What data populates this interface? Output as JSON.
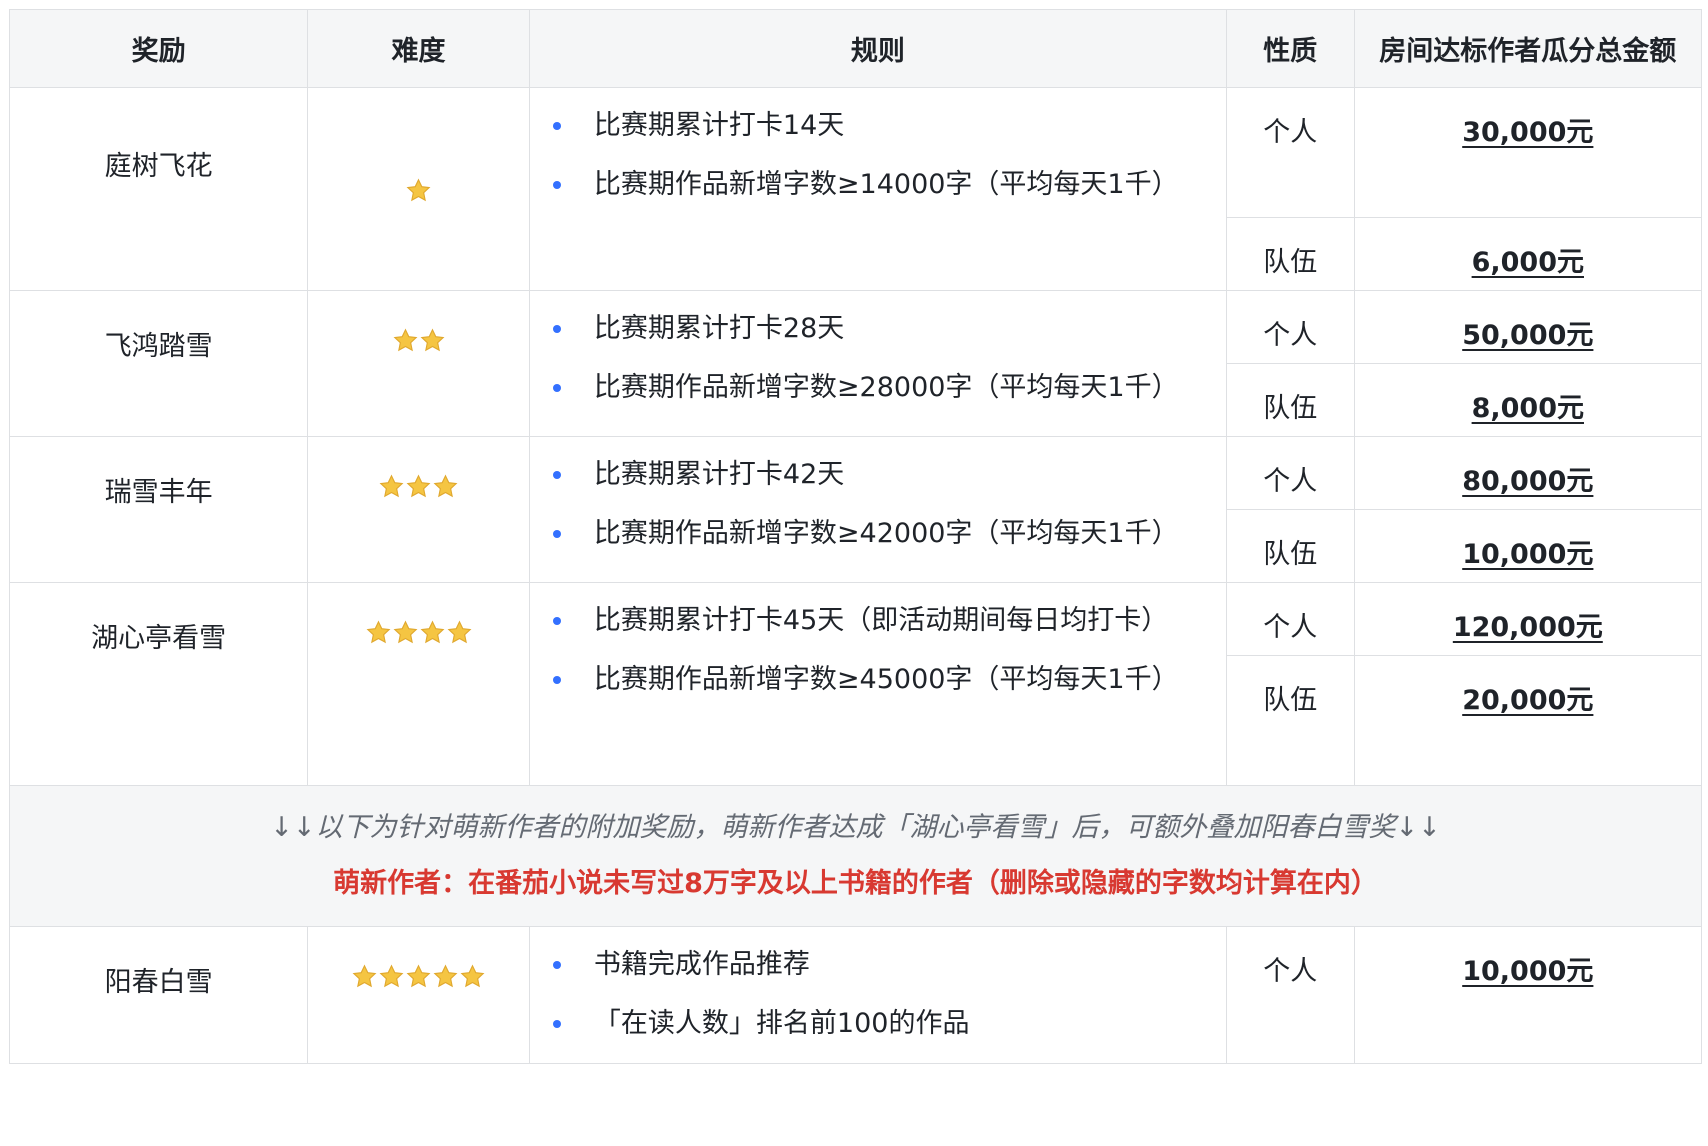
{
  "header": {
    "reward": "奖励",
    "difficulty": "难度",
    "rules": "规则",
    "type": "性质",
    "amount": "房间达标作者瓜分总金额"
  },
  "rows": [
    {
      "name": "庭树飞花",
      "stars": 1,
      "rules": [
        "比赛期累计打卡14天",
        "比赛期作品新增字数≥14000字（平均每天1千）"
      ],
      "tiers": [
        {
          "type": "个人",
          "amount": "30,000元"
        },
        {
          "type": "队伍",
          "amount": "6,000元"
        }
      ]
    },
    {
      "name": "飞鸿踏雪",
      "stars": 2,
      "rules": [
        "比赛期累计打卡28天",
        "比赛期作品新增字数≥28000字（平均每天1千）"
      ],
      "tiers": [
        {
          "type": "个人",
          "amount": "50,000元"
        },
        {
          "type": "队伍",
          "amount": "8,000元"
        }
      ]
    },
    {
      "name": "瑞雪丰年",
      "stars": 3,
      "rules": [
        "比赛期累计打卡42天",
        "比赛期作品新增字数≥42000字（平均每天1千）"
      ],
      "tiers": [
        {
          "type": "个人",
          "amount": "80,000元"
        },
        {
          "type": "队伍",
          "amount": "10,000元"
        }
      ]
    },
    {
      "name": "湖心亭看雪",
      "stars": 4,
      "rules": [
        "比赛期累计打卡45天（即活动期间每日均打卡）",
        "比赛期作品新增字数≥45000字（平均每天1千）"
      ],
      "tiers": [
        {
          "type": "个人",
          "amount": "120,000元"
        },
        {
          "type": "队伍",
          "amount": "20,000元"
        }
      ]
    }
  ],
  "note": {
    "line1": "↓↓以下为针对萌新作者的附加奖励，萌新作者达成「湖心亭看雪」后，可额外叠加阳春白雪奖↓↓",
    "line2": "萌新作者：在番茄小说未写过8万字及以上书籍的作者（删除或隐藏的字数均计算在内）"
  },
  "bonus": {
    "name": "阳春白雪",
    "stars": 5,
    "rules": [
      "书籍完成作品推荐",
      "「在读人数」排名前100的作品"
    ],
    "type": "个人",
    "amount": "10,000元"
  },
  "colors": {
    "border": "#dee0e3",
    "header_bg": "#f5f6f7",
    "bullet": "#3370ff",
    "note_gray": "#646a73",
    "note_red": "#d83931",
    "star": "#f5c542"
  }
}
